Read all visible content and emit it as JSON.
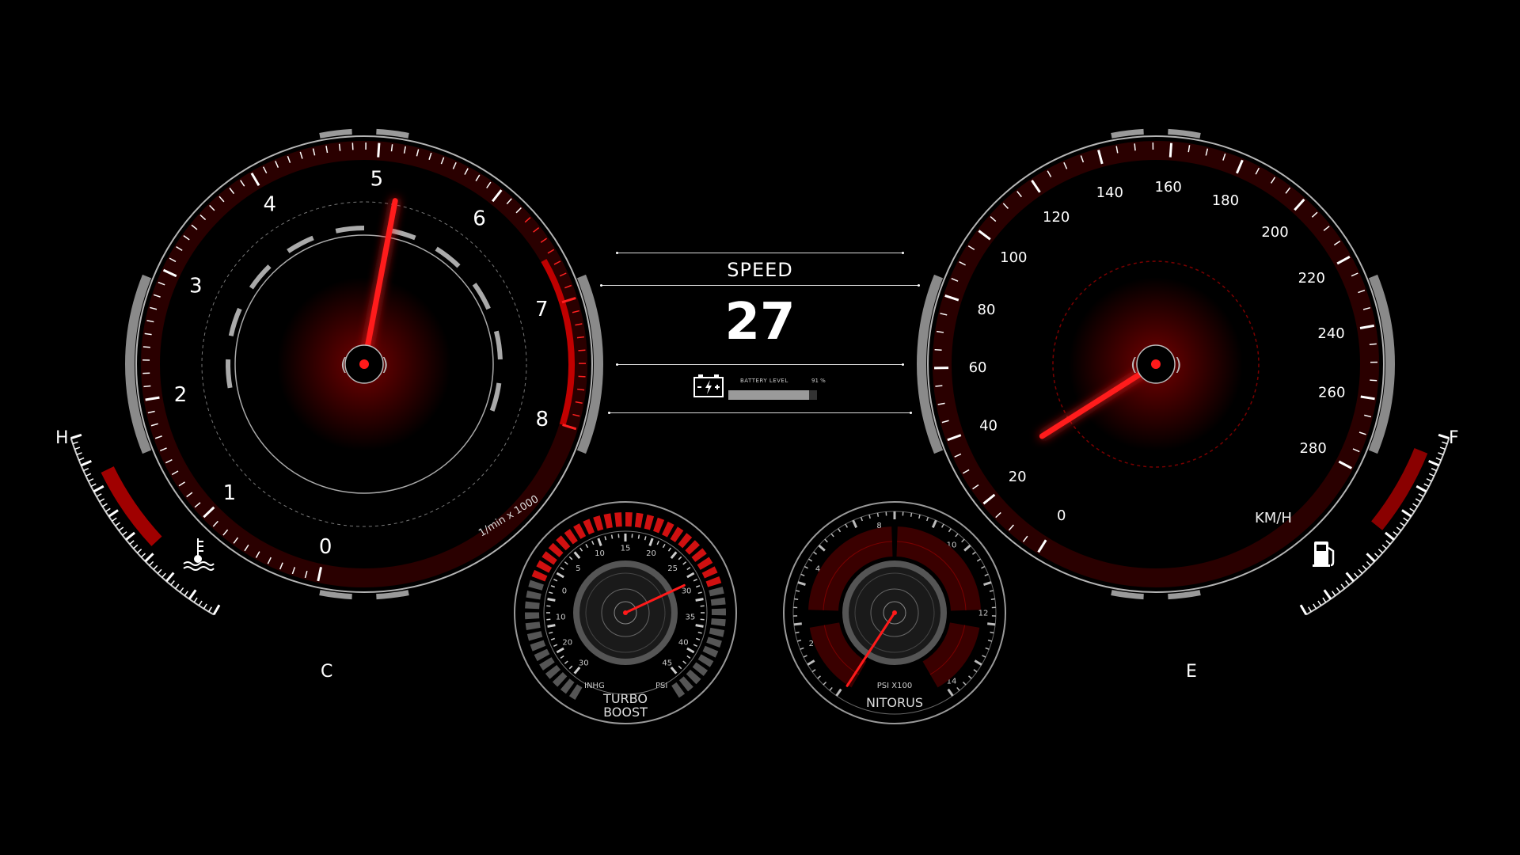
{
  "tachometer": {
    "ticks": [
      "0",
      "1",
      "2",
      "3",
      "4",
      "5",
      "6",
      "7",
      "8"
    ],
    "unit": "1/min x 1000",
    "value": 5.2
  },
  "speedometer": {
    "ticks": [
      "0",
      "20",
      "40",
      "60",
      "80",
      "100",
      "120",
      "140",
      "160",
      "180",
      "200",
      "220",
      "240",
      "260",
      "280"
    ],
    "unit": "KM/H",
    "value": 27
  },
  "center": {
    "speed_label": "SPEED",
    "speed_value": "27",
    "battery_label": "BATTERY LEVEL",
    "battery_percent_text": "91 %",
    "battery_level": 0.91
  },
  "temperature": {
    "hot_label": "H",
    "cold_label": "C",
    "icon": "coolant-temperature-icon",
    "level": 0.25
  },
  "fuel": {
    "full_label": "F",
    "empty_label": "E",
    "icon": "fuel-pump-icon",
    "level": 0.5
  },
  "turbo": {
    "label_line1": "TURBO",
    "label_line2": "BOOST",
    "left_unit": "INHG",
    "right_unit": "PSI",
    "vacuum_ticks": [
      "30",
      "20",
      "10",
      "0",
      "5",
      "10",
      "15"
    ],
    "boost_ticks": [
      "20",
      "25",
      "30",
      "35",
      "40",
      "45"
    ],
    "needle_value": 28
  },
  "nitrous": {
    "label": "NITORUS",
    "unit": "PSI X100",
    "ticks": [
      "2",
      "4",
      "8",
      "10",
      "12",
      "14"
    ],
    "needle_value": 1
  },
  "colors": {
    "accent": "#ff1a1a",
    "dark_red": "#7a0000",
    "chrome": "#9a9a9a"
  }
}
